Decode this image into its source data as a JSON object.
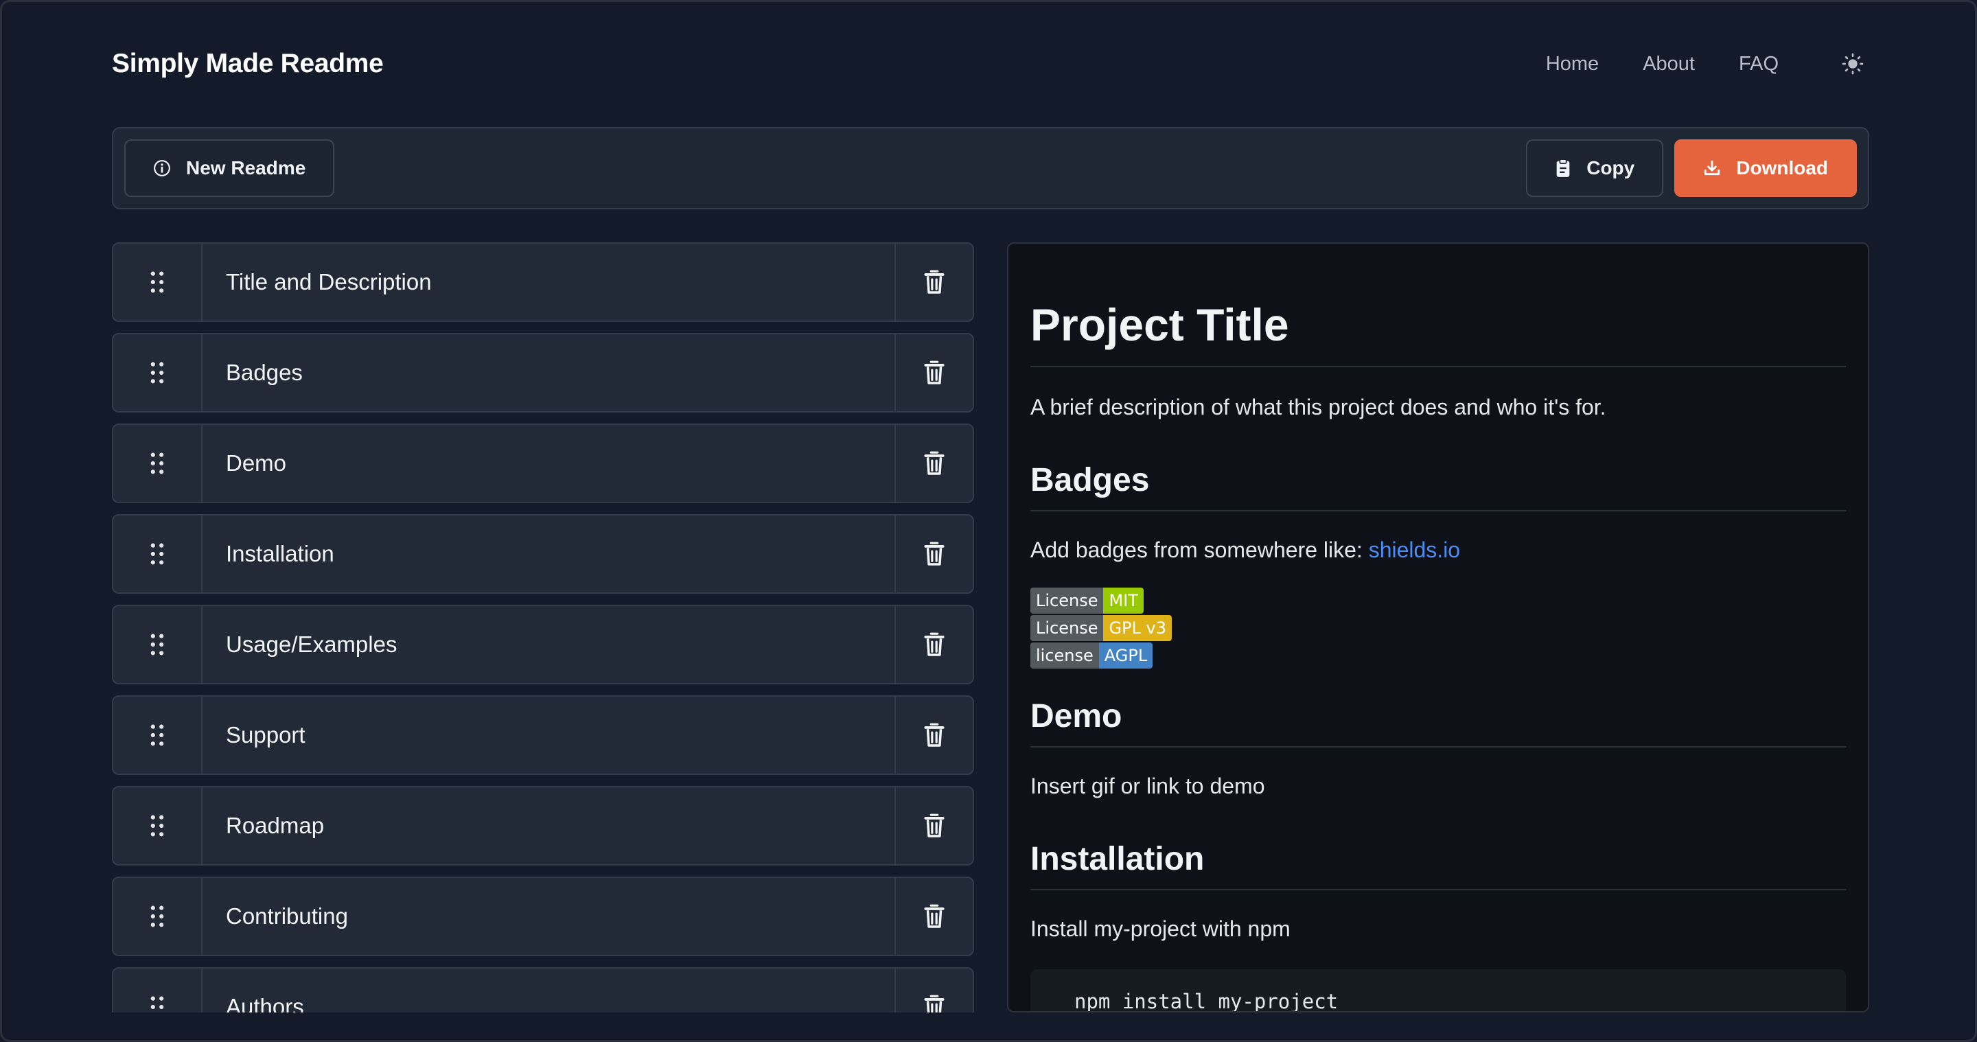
{
  "header": {
    "brand": "Simply Made Readme",
    "nav": [
      "Home",
      "About",
      "FAQ"
    ],
    "theme_icon": "sun-icon"
  },
  "toolbar": {
    "new_label": "New Readme",
    "copy_label": "Copy",
    "download_label": "Download"
  },
  "sections": [
    {
      "label": "Title and Description"
    },
    {
      "label": "Badges"
    },
    {
      "label": "Demo"
    },
    {
      "label": "Installation"
    },
    {
      "label": "Usage/Examples"
    },
    {
      "label": "Support"
    },
    {
      "label": "Roadmap"
    },
    {
      "label": "Contributing"
    },
    {
      "label": "Authors"
    }
  ],
  "preview": {
    "title": "Project Title",
    "description": "A brief description of what this project does and who it's for.",
    "badges_heading": "Badges",
    "badges_text": "Add badges from somewhere like: ",
    "badges_link": "shields.io",
    "badges": [
      {
        "left": "License",
        "right": "MIT",
        "color": "#97ca00"
      },
      {
        "left": "License",
        "right": "GPL v3",
        "color": "#dfb317"
      },
      {
        "left": "license",
        "right": "AGPL",
        "color": "#4183c4"
      }
    ],
    "demo_heading": "Demo",
    "demo_text": "Insert gif or link to demo",
    "install_heading": "Installation",
    "install_text": "Install my-project with npm",
    "install_code": "npm install my-project"
  },
  "colors": {
    "background": "#131b2b",
    "accent": "#e5633d",
    "link": "#4c8df5"
  }
}
